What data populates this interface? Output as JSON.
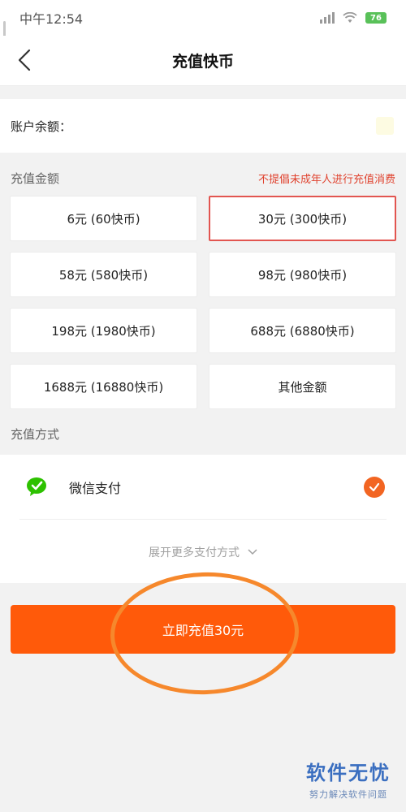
{
  "status_bar": {
    "time": "中午12:54",
    "battery": "76",
    "icons": [
      "signal-icon",
      "wifi-icon",
      "battery-icon"
    ]
  },
  "nav": {
    "title": "充值快币",
    "back_icon": "chevron-left-icon"
  },
  "balance": {
    "label": "账户余额：",
    "coin_icon": "coin-icon"
  },
  "amount_section": {
    "label": "充值金额",
    "warning": "不提倡未成年人进行充值消费",
    "options": [
      {
        "label": "6元 (60快币)"
      },
      {
        "label": "30元 (300快币)"
      },
      {
        "label": "58元 (580快币)"
      },
      {
        "label": "98元 (980快币)"
      },
      {
        "label": "198元 (1980快币)"
      },
      {
        "label": "688元 (6880快币)"
      },
      {
        "label": "1688元 (16880快币)"
      },
      {
        "label": "其他金额"
      }
    ],
    "selected_label": "30元 (300快币)"
  },
  "payment_section": {
    "label": "充值方式",
    "method": {
      "name": "微信支付",
      "icon": "wechat-icon",
      "checked_icon": "check-circle-icon"
    },
    "expand_label": "展开更多支付方式",
    "expand_icon": "chevron-down-icon"
  },
  "cta": {
    "label": "立即充值30元"
  },
  "watermark": {
    "main": "软件无忧",
    "sub": "努力解决软件问题"
  },
  "colors": {
    "accent": "#ff5a0a",
    "selected_border": "#e25550",
    "warning": "#e0432f",
    "wechat": "#2dc100",
    "highlight_ring": "#f6882c"
  }
}
